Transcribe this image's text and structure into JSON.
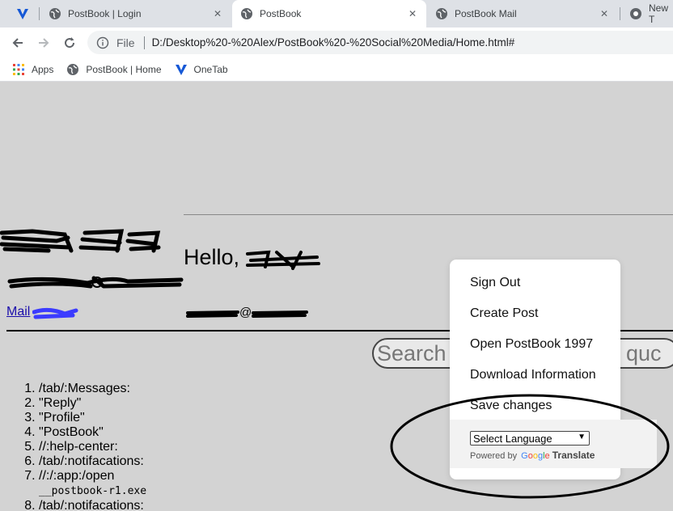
{
  "browser": {
    "tabs": [
      {
        "title": "",
        "icon": "vivaldi-v-icon"
      },
      {
        "title": "PostBook | Login",
        "icon": "globe-icon"
      },
      {
        "title": "PostBook",
        "icon": "globe-icon",
        "active": true
      },
      {
        "title": "PostBook Mail",
        "icon": "globe-icon"
      },
      {
        "title": "New T",
        "icon": "chrome-icon"
      }
    ],
    "address": {
      "scheme": "File",
      "url": "D:/Desktop%20-%20Alex/PostBook%20-%20Social%20Media/Home.html#"
    },
    "bookmarks": [
      {
        "label": "Apps",
        "icon": "apps-grid-icon"
      },
      {
        "label": "PostBook | Home",
        "icon": "globe-icon"
      },
      {
        "label": "OneTab",
        "icon": "onetab-v-icon"
      }
    ]
  },
  "page": {
    "greeting": "Hello,",
    "mail_link": "Mail",
    "email_fragment": "@",
    "search": {
      "placeholder_start": "Search",
      "placeholder_end": "quc"
    },
    "commands": [
      "/tab/:Messages:",
      "\"Reply\"",
      "\"Profile\"",
      "\"PostBook\"",
      "//:help-center:",
      "/tab/:notifacations:",
      "//:/:app:/open",
      "/tab/:notifacations:"
    ],
    "command_7_sub": "__postbook-r1.exe"
  },
  "menu": {
    "items": [
      "Sign Out",
      "Create Post",
      "Open PostBook 1997",
      "Download Information",
      "Save changes"
    ],
    "language_select": "Select Language",
    "powered_by": "Powered by",
    "google": [
      "G",
      "o",
      "o",
      "g",
      "l",
      "e"
    ],
    "translate": "Translate"
  },
  "colors": {
    "page_bg": "#d3d3d3",
    "link": "#1a0dab",
    "annotation": "#000000"
  }
}
